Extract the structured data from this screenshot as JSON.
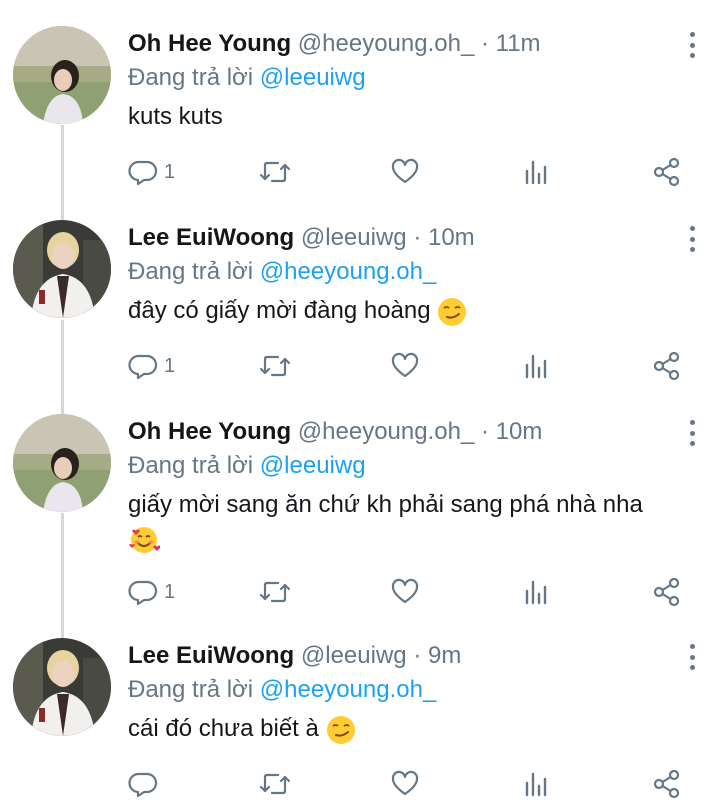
{
  "reply_prefix": "Đang trả lời",
  "tweets": [
    {
      "name": "Oh Hee Young",
      "handle": "@heeyoung.oh_",
      "time": "· 11m",
      "reply_to": "@leeuiwg",
      "text": "kuts kuts",
      "reply_count": "1",
      "avatar": "girl-photo"
    },
    {
      "name": "Lee EuiWoong",
      "handle": "@leeuiwg",
      "time": "· 10m",
      "reply_to": "@heeyoung.oh_",
      "text": "đây có giấy mời đàng hoàng",
      "emoji": "smirk-emoji",
      "reply_count": "1",
      "avatar": "boy-photo"
    },
    {
      "name": "Oh Hee Young",
      "handle": "@heeyoung.oh_",
      "time": "· 10m",
      "reply_to": "@leeuiwg",
      "text": "giấy mời sang ăn chứ kh phải sang phá nhà nha",
      "emoji": "smiling-face-with-hearts-emoji",
      "reply_count": "1",
      "avatar": "girl-photo"
    },
    {
      "name": "Lee EuiWoong",
      "handle": "@leeuiwg",
      "time": "· 9m",
      "reply_to": "@heeyoung.oh_",
      "text": "cái đó chưa biết à",
      "emoji": "smirk-emoji",
      "reply_count": "",
      "avatar": "boy-photo"
    }
  ],
  "colors": {
    "accent": "#1da1f2",
    "secondary_text": "#657786",
    "thread_line": "#cfd9de"
  }
}
